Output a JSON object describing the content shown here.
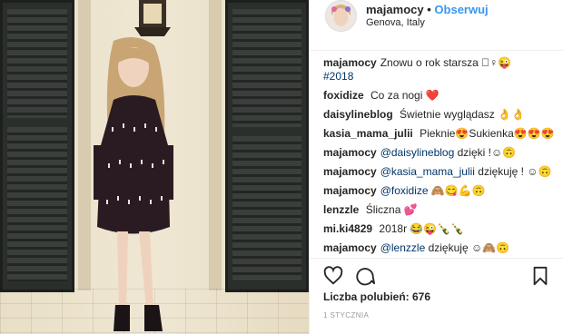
{
  "post": {
    "username": "majamocy",
    "separator": "•",
    "follow_label": "Obserwuj",
    "location": "Genova, Italy"
  },
  "caption": {
    "user": "majamocy",
    "text": "Znowu o rok starsza 🏻♀😜",
    "hashtag": "#2018"
  },
  "comments": [
    {
      "user": "foxidize",
      "mention": "",
      "text": "Co za nogi ❤️"
    },
    {
      "user": "daisylineblog",
      "mention": "",
      "text": "Świetnie wyglądasz 👌👌"
    },
    {
      "user": "kasia_mama_julii",
      "mention": "",
      "text": "Pieknie😍Sukienka😍😍😍"
    },
    {
      "user": "majamocy",
      "mention": "@daisylineblog",
      "text": "dzięki !☺🙃"
    },
    {
      "user": "majamocy",
      "mention": "@kasia_mama_julii",
      "text": "dziękuję ! ☺🙃"
    },
    {
      "user": "majamocy",
      "mention": "@foxidize",
      "text": "🙈😋💪🙃"
    },
    {
      "user": "lenzzle",
      "mention": "",
      "text": "Śliczna 💕"
    },
    {
      "user": "mi.ki4829",
      "mention": "",
      "text": "2018r 😂😜🍾🍾"
    },
    {
      "user": "majamocy",
      "mention": "@lenzzle",
      "text": "dziękuję ☺🙈🙃"
    }
  ],
  "likes_label": "Liczba polubień: 676",
  "date": "1 STYCZNIA",
  "icons": {
    "like": "heart-outline-icon",
    "comment": "comment-bubble-icon",
    "save": "bookmark-icon"
  }
}
